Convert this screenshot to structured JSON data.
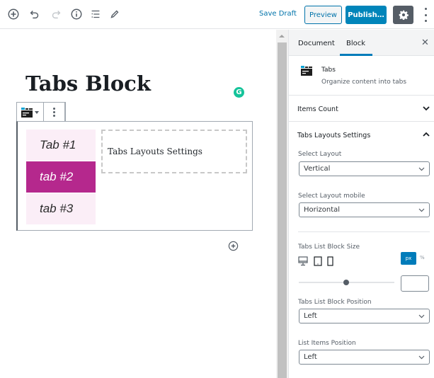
{
  "topbar": {
    "icons": [
      "add-block-icon",
      "undo-icon",
      "redo-icon",
      "info-icon",
      "outline-icon",
      "edit-tools-icon"
    ],
    "save_draft": "Save Draft",
    "preview": "Preview",
    "publish": "Publish…",
    "settings_icon": "gear-icon",
    "more_icon": "more-vertical-icon"
  },
  "editor": {
    "title": "Tabs Block",
    "grammarly_badge": "G",
    "tabs": [
      {
        "label": "Tab #1",
        "active": false
      },
      {
        "label": "tab #2",
        "active": true
      },
      {
        "label": "tab #3",
        "active": false
      }
    ],
    "tab_content": "Tabs Layouts Settings",
    "accent_color": "#b5288d",
    "tab_bg_color": "#fbeef7"
  },
  "sidebar": {
    "tabs": [
      "Document",
      "Block"
    ],
    "active_tab": "Block",
    "block_card": {
      "title": "Tabs",
      "description": "Organize content into tabs"
    },
    "panels": {
      "items_count": "Items Count",
      "layouts_settings": "Tabs Layouts Settings"
    },
    "fields": {
      "select_layout_label": "Select Layout",
      "select_layout_value": "Vertical",
      "select_layout_mobile_label": "Select Layout mobile",
      "select_layout_mobile_value": "Horizontal",
      "block_size_label": "Tabs List Block Size",
      "unit_px": "px",
      "unit_pct": "%",
      "active_unit": "px",
      "block_size_value": "",
      "block_position_label": "Tabs List Block Position",
      "block_position_value": "Left",
      "items_position_label": "List Items Position",
      "items_position_value": "Left"
    },
    "device_icons": [
      "desktop-icon",
      "tablet-icon",
      "mobile-icon"
    ]
  }
}
